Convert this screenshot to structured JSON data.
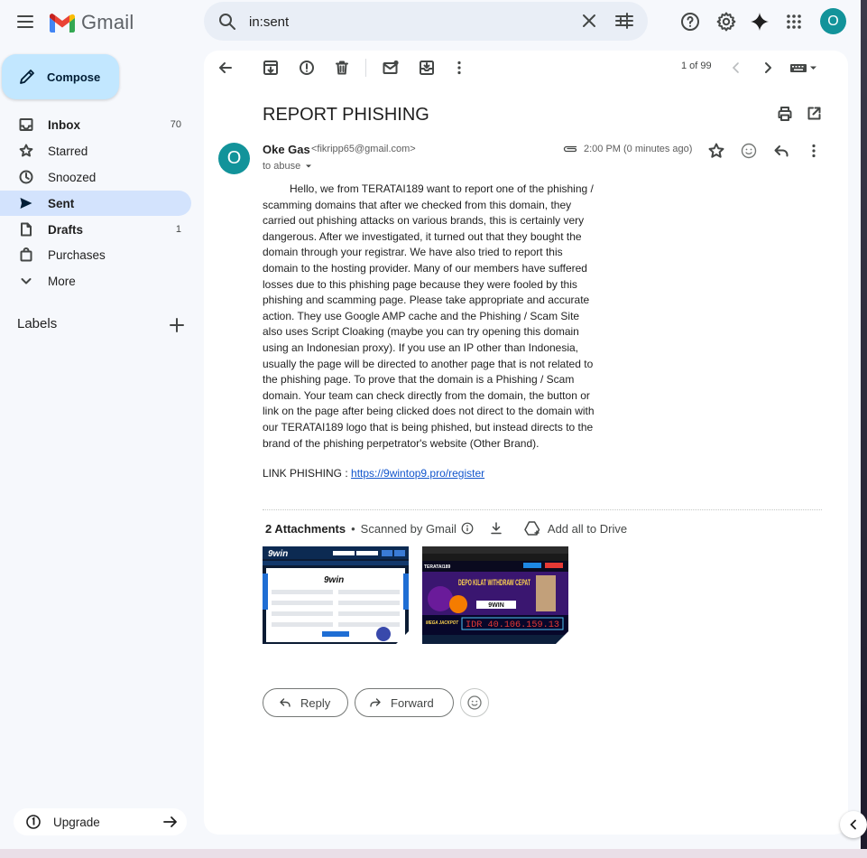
{
  "app": {
    "name": "Gmail"
  },
  "search": {
    "value": "in:sent"
  },
  "account": {
    "initial": "O"
  },
  "sidebar": {
    "compose_label": "Compose",
    "items": [
      {
        "label": "Inbox",
        "count": "70",
        "icon": "inbox-icon",
        "bold": true
      },
      {
        "label": "Starred",
        "count": "",
        "icon": "star-icon",
        "bold": false
      },
      {
        "label": "Snoozed",
        "count": "",
        "icon": "clock-icon",
        "bold": false
      },
      {
        "label": "Sent",
        "count": "",
        "icon": "send-icon",
        "bold": true,
        "active": true
      },
      {
        "label": "Drafts",
        "count": "1",
        "icon": "draft-icon",
        "bold": true
      },
      {
        "label": "Purchases",
        "count": "",
        "icon": "shopping-bag-icon",
        "bold": false
      },
      {
        "label": "More",
        "count": "",
        "icon": "chevron-down-icon",
        "bold": false
      }
    ],
    "labels_heading": "Labels",
    "upgrade_label": "Upgrade"
  },
  "toolbar": {
    "pager": "1 of 99"
  },
  "email": {
    "subject": "REPORT PHISHING",
    "sender_initial": "O",
    "sender_name": "Oke Gas",
    "sender_email": "<fikripp65@gmail.com>",
    "to_line": "to abuse",
    "time": "2:00 PM (0 minutes ago)",
    "body": "Hello, we from TERATAI189 want to report one of the phishing / scamming domains that after we checked from this domain, they carried out phishing attacks on various brands, this is certainly very dangerous. After we investigated, it turned out that they bought the domain through your registrar. We have also tried to report this domain to the hosting provider. Many of our members have suffered losses due to this phishing page because they were fooled by this phishing and scamming page. Please take appropriate and accurate action. They use Google AMP cache and the Phishing / Scam Site also uses Script Cloaking (maybe you can try opening this domain using an Indonesian proxy). If you use an IP other than Indonesia, usually the page will be directed to another page that is not related to the phishing page. To prove that the domain is a Phishing / Scam domain. Your team can check directly from the domain, the button or link on the page after being clicked does not direct to the domain with our TERATAI189 logo that is being phished, but instead directs to the brand of the phishing perpetrator's website (Other Brand).",
    "link_label": "LINK PHISHING : ",
    "link_url": "https://9wintop9.pro/register"
  },
  "attachments": {
    "count_label": "2 Attachments",
    "scanned_label": "Scanned by Gmail",
    "add_all_label": "Add all to Drive",
    "thumb1_logo": "9win",
    "thumb2_brand": "TERATAI189",
    "thumb2_headline": "DEPO KILAT WITHDRAW CEPAT",
    "thumb2_logo": "9WIN",
    "thumb2_jackpot_label": "MEGA JACKPOT",
    "thumb2_jackpot_value": "IDR 40.106.159.13"
  },
  "actions": {
    "reply_label": "Reply",
    "forward_label": "Forward"
  },
  "colors": {
    "accent": "#0b57d0",
    "active_nav": "#d3e3fd",
    "compose": "#c2e7ff",
    "avatar": "#12939a"
  }
}
